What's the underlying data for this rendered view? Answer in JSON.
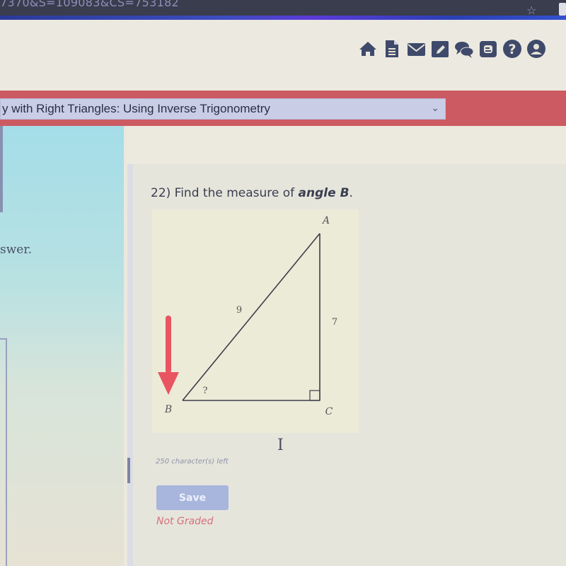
{
  "browser": {
    "url_fragment": "7370&S=109083&CS=753182",
    "bookmark_icon": "star-icon"
  },
  "nav_icons": [
    {
      "name": "home-icon"
    },
    {
      "name": "document-icon"
    },
    {
      "name": "mail-icon"
    },
    {
      "name": "edit-icon"
    },
    {
      "name": "chat-icon"
    },
    {
      "name": "blog-icon"
    },
    {
      "name": "help-icon"
    },
    {
      "name": "user-icon"
    }
  ],
  "topic": {
    "selected": "y with Right Triangles: Using Inverse Trigonometry"
  },
  "left_panel": {
    "instruction_fragment": "swer."
  },
  "question": {
    "prefix": "22) Find the measure of ",
    "emphasis": "angle B",
    "suffix": "."
  },
  "figure": {
    "vertex_a": "A",
    "vertex_b": "B",
    "vertex_c": "C",
    "hypotenuse": "9",
    "side_ac": "7",
    "unknown_angle": "?",
    "arrow_color": "#e85560"
  },
  "answer": {
    "chars_left": "250 character(s) left",
    "save_label": "Save",
    "status": "Not Graded"
  },
  "colors": {
    "topic_bar": "#cc5a62",
    "save_button": "#a8b5dc",
    "status": "#d5707a",
    "icons": "#3f4a6b"
  }
}
